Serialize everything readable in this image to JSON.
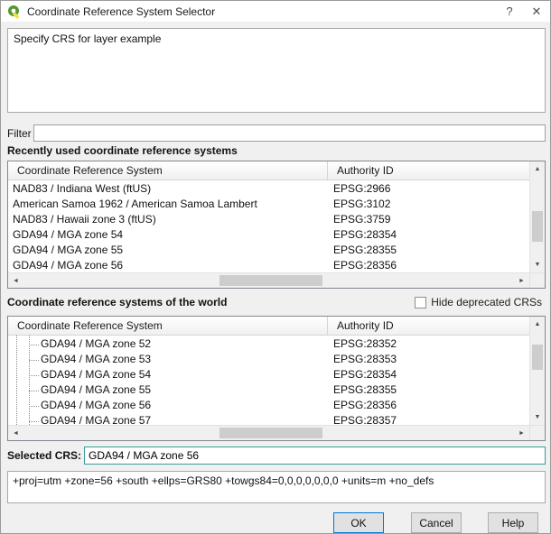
{
  "window": {
    "title": "Coordinate Reference System Selector",
    "help_glyph": "?",
    "close_glyph": "✕"
  },
  "description": "Specify CRS for layer example",
  "filter": {
    "label": "Filter",
    "value": ""
  },
  "recent": {
    "heading": "Recently used coordinate reference systems",
    "columns": [
      "Coordinate Reference System",
      "Authority ID"
    ],
    "rows": [
      {
        "crs": "NAD83 / Indiana West (ftUS)",
        "authority": "EPSG:2966"
      },
      {
        "crs": "American Samoa 1962 / American Samoa Lambert",
        "authority": "EPSG:3102"
      },
      {
        "crs": "NAD83 / Hawaii zone 3 (ftUS)",
        "authority": "EPSG:3759"
      },
      {
        "crs": "GDA94 / MGA zone 54",
        "authority": "EPSG:28354"
      },
      {
        "crs": "GDA94 / MGA zone 55",
        "authority": "EPSG:28355"
      },
      {
        "crs": "GDA94 / MGA zone 56",
        "authority": "EPSG:28356"
      }
    ]
  },
  "world": {
    "heading": "Coordinate reference systems of the world",
    "hide_deprecated_label": "Hide deprecated CRSs",
    "hide_deprecated_checked": false,
    "columns": [
      "Coordinate Reference System",
      "Authority ID"
    ],
    "rows": [
      {
        "crs": "GDA94 / MGA zone 52",
        "authority": "EPSG:28352"
      },
      {
        "crs": "GDA94 / MGA zone 53",
        "authority": "EPSG:28353"
      },
      {
        "crs": "GDA94 / MGA zone 54",
        "authority": "EPSG:28354"
      },
      {
        "crs": "GDA94 / MGA zone 55",
        "authority": "EPSG:28355"
      },
      {
        "crs": "GDA94 / MGA zone 56",
        "authority": "EPSG:28356"
      },
      {
        "crs": "GDA94 / MGA zone 57",
        "authority": "EPSG:28357"
      }
    ]
  },
  "selected": {
    "label": "Selected CRS:",
    "value": "GDA94 / MGA zone 56"
  },
  "proj_string": "+proj=utm +zone=56 +south +ellps=GRS80 +towgs84=0,0,0,0,0,0,0 +units=m +no_defs",
  "buttons": {
    "ok": "OK",
    "cancel": "Cancel",
    "help": "Help"
  },
  "icons": {
    "scroll_up": "▲",
    "scroll_down": "▼",
    "scroll_left": "◄",
    "scroll_right": "►"
  },
  "colors": {
    "selected_input_border": "#359d98",
    "default_button_border": "#0078d7"
  }
}
